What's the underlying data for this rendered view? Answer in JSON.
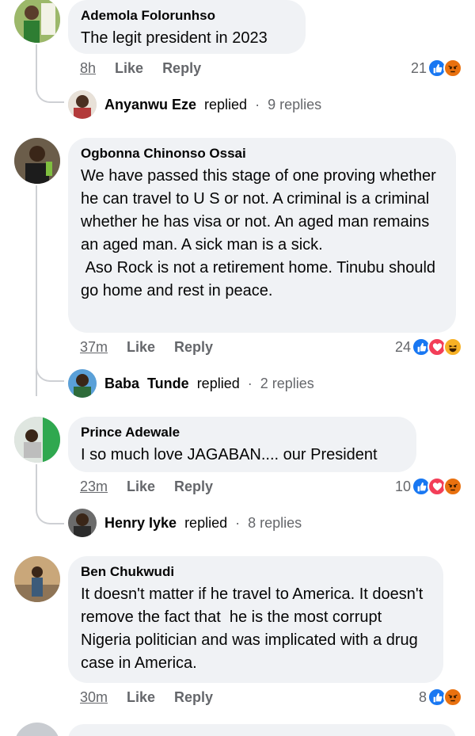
{
  "comments": [
    {
      "author": "Ademola Folorunhso",
      "text": "The legit president in 2023",
      "time": "8h",
      "like_label": "Like",
      "reply_label": "Reply",
      "reaction_count": "21",
      "reactions": [
        "like",
        "angry"
      ],
      "replies": {
        "name": "Anyanwu Eze",
        "replied_label": "replied",
        "dot": "·",
        "count_label": "9 replies"
      }
    },
    {
      "author": "Ogbonna Chinonso Ossai",
      "text": "We have passed this stage of one proving whether he can travel to U S or not. A criminal is a criminal whether he has visa or not. An aged man remains an aged man. A sick man is a sick.\n Aso Rock is not a retirement home. Tinubu should go home and rest in peace.",
      "time": "37m",
      "like_label": "Like",
      "reply_label": "Reply",
      "reaction_count": "24",
      "reactions": [
        "like",
        "love",
        "haha"
      ],
      "replies": {
        "name": "Baba  Tunde",
        "replied_label": "replied",
        "dot": "·",
        "count_label": "2 replies"
      }
    },
    {
      "author": "Prince Adewale",
      "text": "I so much love JAGABAN.... our President",
      "time": "23m",
      "like_label": "Like",
      "reply_label": "Reply",
      "reaction_count": "10",
      "reactions": [
        "like",
        "love",
        "angry"
      ],
      "replies": {
        "name": "Henry Iyke",
        "replied_label": "replied",
        "dot": "·",
        "count_label": "8 replies"
      }
    },
    {
      "author": "Ben Chukwudi",
      "text": "It doesn't matter if he travel to America. It doesn't remove the fact that  he is the most corrupt Nigeria politician and was implicated with a drug case in America.",
      "time": "30m",
      "like_label": "Like",
      "reply_label": "Reply",
      "reaction_count": "8",
      "reactions": [
        "like",
        "angry"
      ]
    }
  ],
  "colors": {
    "bubble": "#f0f2f5",
    "meta_text": "#65676b",
    "like": "#1877f2",
    "love": "#f33e58",
    "angry": "#e9710f",
    "haha": "#f7b125",
    "thread": "#ced0d4"
  },
  "icons": {
    "like": "thumbs-up-icon",
    "love": "heart-icon",
    "angry": "angry-face-icon",
    "haha": "laughing-face-icon"
  }
}
